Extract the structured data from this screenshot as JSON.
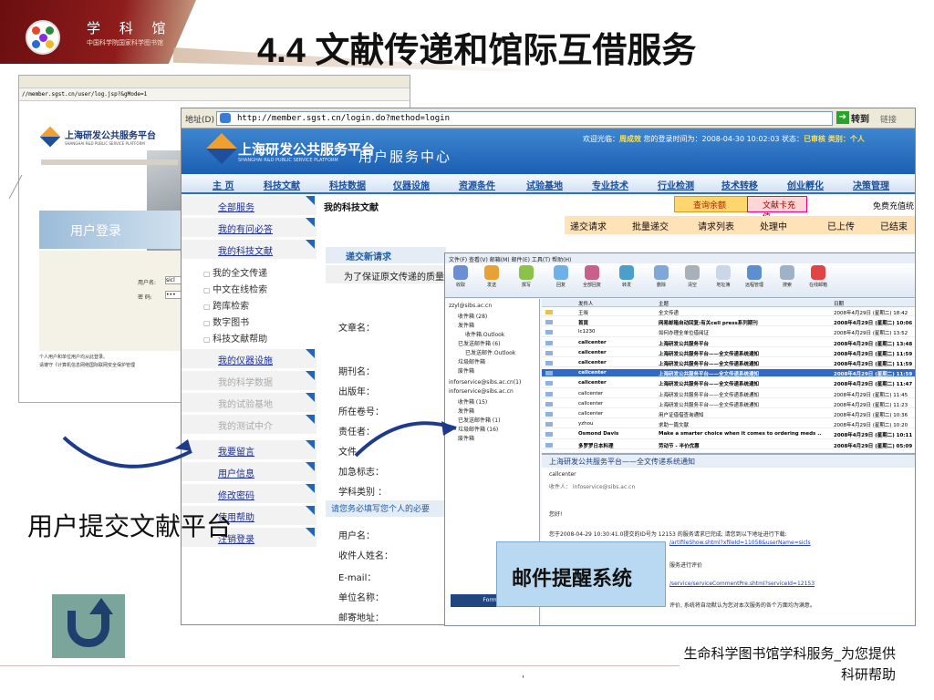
{
  "slide": {
    "title": "4.4 文献传递和馆际互借服务",
    "logo_text": "学 科 馆 员",
    "logo_sub": "中国科学院国家科学图书馆",
    "left_caption": "用户提交文献平台",
    "mail_caption": "邮件提醒系统",
    "footer_line1": "生命科学图书馆学科服务_为您提供",
    "footer_line2": "科研帮助",
    "footer_mark": "'"
  },
  "back_window": {
    "address": "//member.sgst.cn/user/log.jsp?&gMode=1",
    "logo": "上海研发公共服务平台",
    "logo_eng": "SHANGHAI R&D PUBLIC SERVICE PLATFORM",
    "login_title": "用户登录",
    "user_label": "用户名:",
    "user_value": "sicl",
    "pass_label": "密  码:",
    "pass_value": "•••",
    "footer1": "个人用户和单位用户均从此登录。",
    "footer2": "请遵守《计算机信息网络国际联网安全保护管理"
  },
  "main_window": {
    "address_label": "地址(D)",
    "address": "http://member.sgst.cn/login.do?method=login",
    "go": "转到",
    "links": "链接",
    "site_name": "上海研发公共服务平台",
    "site_eng": "SHANGHAI R&D PUBLIC SERVICE PLATFORM",
    "site_center": "用户服务中心",
    "welcome_prefix": "欢迎光临：",
    "welcome_user": "周成效",
    "welcome_mid": " 您的登录时间为：2008-04-30 10:02:03 状态：",
    "welcome_status": "已审核",
    "welcome_suffix": " 类别：个人",
    "nav": [
      "主 页",
      "科技文献",
      "科技数据",
      "仪器设施",
      "资源条件",
      "试验基地",
      "专业技术",
      "行业检测",
      "技术转移",
      "创业孵化",
      "决策管理"
    ],
    "sidebar": {
      "all": "全部服务",
      "mine_required": "我的有问必答",
      "mine_docs": "我的科技文献",
      "subs": [
        "我的全文传递",
        "中文在线检索",
        "跨库检索",
        "数字图书",
        "科技文献帮助"
      ],
      "instruments": "我的仪器设施",
      "data": "我的科学数据",
      "base": "我的试验基地",
      "test": "我的测试中介",
      "messages": "我要留言",
      "userinfo": "用户信息",
      "password": "修改密码",
      "help": "使用帮助",
      "logout": "注销登录"
    },
    "content_title": "我的科技文献",
    "btn_balance": "查询余额",
    "btn_recharge": "文献卡充值",
    "free_label": "免费充值统",
    "tabs": [
      "递交请求",
      "批量递交",
      "请求列表",
      "处理中",
      "已上传",
      "已结束"
    ],
    "new_request": "递交新请求",
    "notice": "为了保证原文传递的质量",
    "fields1": [
      "文章名：",
      "期刊名：",
      "出版年：",
      "所在卷号：",
      "责任者：",
      "文件",
      "加急标志：",
      "学科类别 ："
    ],
    "section2": "请您务必填写您个人的必要",
    "fields2": [
      "用户名：",
      "收件人姓名：",
      "E-mail：",
      "单位名称：",
      "邮寄地址："
    ]
  },
  "mail": {
    "menu": "文件(F)  查看(V)  邮箱(M)  邮件(E)  工具(T)  帮助(H)",
    "tools": [
      "收取",
      "发送",
      "撰写",
      "回复",
      "全部回复",
      "转发",
      "删除",
      "清空",
      "地址簿",
      "远程管理",
      "搜索",
      "在线邮箱"
    ],
    "folders": [
      "zzyl@sibs.ac.cn",
      "收件箱 (28)",
      "发件箱",
      "收件箱.Outlook",
      "已发送邮件箱 (6)",
      "已发送邮件.Outlook",
      "垃圾邮件箱",
      "废件箱",
      "inforservice@sibs.ac.cn(1)",
      "inforservice@sibs.ac.cn",
      "收件箱 (15)",
      "发件箱",
      "已发送邮件箱 (1)",
      "垃圾邮件箱 (16)",
      "废件箱"
    ],
    "headers": [
      "发件人",
      "主题",
      "日期"
    ],
    "rows": [
      [
        "王晓",
        "全文传递",
        "2008年4月29日 (星期二) 18:42"
      ],
      [
        "首頁",
        "网易邮箱自动回复:有关cell press系列期刊",
        "2008年4月29日 (星期二) 10:06"
      ],
      [
        "lc1230",
        "如何办理全单位借阅证",
        "2008年4月29日 (星期二) 13:52"
      ],
      [
        "callcenter",
        "上海研发公共服务平台",
        "2008年4月29日 (星期二) 13:48"
      ],
      [
        "callcenter",
        "上海研发公共服务平台——全文传递系统通知",
        "2008年4月29日 (星期二) 11:59"
      ],
      [
        "callcenter",
        "上海研发公共服务平台——全文传递系统通知",
        "2008年4月29日 (星期二) 11:59"
      ],
      [
        "callcenter",
        "上海研发公共服务平台——全文传递系统通知",
        "2008年4月29日 (星期二) 11:59"
      ],
      [
        "callcenter",
        "上海研发公共服务平台——全文传递系统通知",
        "2008年4月29日 (星期二) 11:47"
      ],
      [
        "callcenter",
        "上海研发公共服务平台——全文传递系统通知",
        "2008年4月29日 (星期二) 11:45"
      ],
      [
        "callcenter",
        "上海研发公共服务平台——全文传递系统通知",
        "2008年4月29日 (星期二) 11:23"
      ],
      [
        "callcenter",
        "用户证借借查询通知",
        "2008年4月29日 (星期二) 10:36"
      ],
      [
        "yzhou",
        "求助一篇文献",
        "2008年4月29日 (星期二) 10:20"
      ],
      [
        "Osmond Davis",
        "Make a smarter choice when it comes to ordering meds ..",
        "2008年4月29日 (星期二) 10:11"
      ],
      [
        "多罗罗日本料理",
        "劳动节 - 半价优惠",
        "2008年4月29日 (星期二) 05:09"
      ]
    ],
    "preview_title": "上海研发公共服务平台——全文传递系统通知",
    "preview_from": "callcenter",
    "preview_to": "收件人： infoservice@sibs.ac.cn",
    "preview_hello": "您好!",
    "preview_body": "您于2008-04-29 10:30:41.0提交的ID号为  12153  的服务请求已完成; 请您到以下地址进行下载:",
    "preview_link1": "/artifileShow.shtml?xfileId=11058&userName=sicls",
    "preview_eval": "服务进行评价",
    "preview_link2": "/service/serviceCommentPre.shtml?serviceId=12153",
    "preview_tail": "评价, 系统将自动默认为您对本次服务的各个方面均为满意。",
    "button_hidden": "Format"
  }
}
